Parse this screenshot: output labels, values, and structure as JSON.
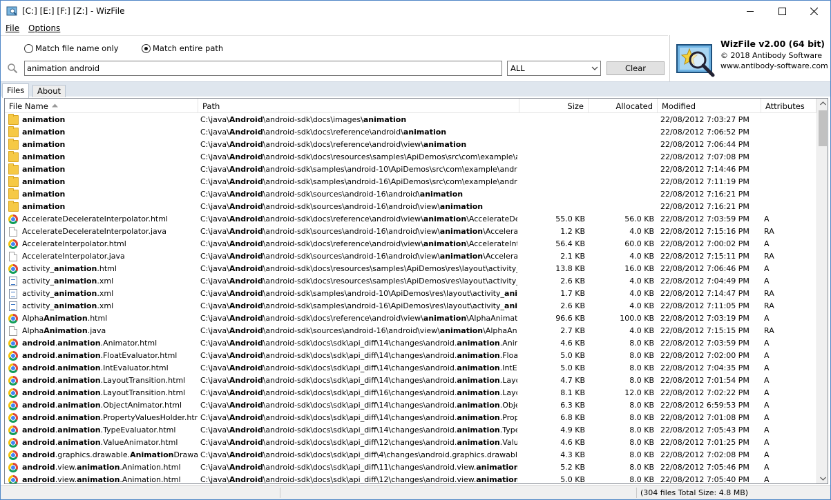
{
  "window": {
    "title": "[C:] [E:] [F:] [Z:]  - WizFile"
  },
  "menu": {
    "file": "File",
    "options": "Options"
  },
  "search": {
    "match_name_label": "Match file name only",
    "match_path_label": "Match entire path",
    "selected_mode": "path",
    "query": "animation android",
    "filter_value": "ALL",
    "clear_label": "Clear"
  },
  "brand": {
    "name": "WizFile v2.00 (64 bit)",
    "copyright": "© 2018 Antibody Software",
    "website": "www.antibody-software.com"
  },
  "tabs": {
    "files": "Files",
    "about": "About"
  },
  "columns": {
    "name": "File Name",
    "path": "Path",
    "size": "Size",
    "allocated": "Allocated",
    "modified": "Modified",
    "attributes": "Attributes"
  },
  "rows": [
    {
      "icon": "folder",
      "name": "<b>animation</b>",
      "path": "C:\\java\\<b>Android</b>\\android-sdk\\docs\\images\\<b>animation</b>",
      "size": "",
      "alloc": "",
      "modified": "22/08/2012 7:03:27 PM",
      "attr": ""
    },
    {
      "icon": "folder",
      "name": "<b>animation</b>",
      "path": "C:\\java\\<b>Android</b>\\android-sdk\\docs\\reference\\android\\<b>animation</b>",
      "size": "",
      "alloc": "",
      "modified": "22/08/2012 7:06:52 PM",
      "attr": ""
    },
    {
      "icon": "folder",
      "name": "<b>animation</b>",
      "path": "C:\\java\\<b>Android</b>\\android-sdk\\docs\\reference\\android\\view\\<b>animation</b>",
      "size": "",
      "alloc": "",
      "modified": "22/08/2012 7:06:44 PM",
      "attr": ""
    },
    {
      "icon": "folder",
      "name": "<b>animation</b>",
      "path": "C:\\java\\<b>Android</b>\\android-sdk\\docs\\resources\\samples\\ApiDemos\\src\\com\\example\\android\\apis",
      "size": "",
      "alloc": "",
      "modified": "22/08/2012 7:07:08 PM",
      "attr": ""
    },
    {
      "icon": "folder",
      "name": "<b>animation</b>",
      "path": "C:\\java\\<b>Android</b>\\android-sdk\\samples\\android-10\\ApiDemos\\src\\com\\example\\android\\apis\\<b>an</b>",
      "size": "",
      "alloc": "",
      "modified": "22/08/2012 7:14:46 PM",
      "attr": ""
    },
    {
      "icon": "folder",
      "name": "<b>animation</b>",
      "path": "C:\\java\\<b>Android</b>\\android-sdk\\samples\\android-16\\ApiDemos\\src\\com\\example\\android\\apis\\<b>an</b>",
      "size": "",
      "alloc": "",
      "modified": "22/08/2012 7:11:19 PM",
      "attr": ""
    },
    {
      "icon": "folder",
      "name": "<b>animation</b>",
      "path": "C:\\java\\<b>Android</b>\\android-sdk\\sources\\android-16\\android\\<b>animation</b>",
      "size": "",
      "alloc": "",
      "modified": "22/08/2012 7:16:21 PM",
      "attr": ""
    },
    {
      "icon": "folder",
      "name": "<b>animation</b>",
      "path": "C:\\java\\<b>Android</b>\\android-sdk\\sources\\android-16\\android\\view\\<b>animation</b>",
      "size": "",
      "alloc": "",
      "modified": "22/08/2012 7:16:21 PM",
      "attr": ""
    },
    {
      "icon": "chrome",
      "name": "AccelerateDecelerateInterpolator.html",
      "path": "C:\\java\\<b>Android</b>\\android-sdk\\docs\\reference\\android\\view\\<b>animation</b>\\AccelerateDecelerateI",
      "size": "55.0 KB",
      "alloc": "56.0 KB",
      "modified": "22/08/2012 7:03:59 PM",
      "attr": "A"
    },
    {
      "icon": "doc",
      "name": "AccelerateDecelerateInterpolator.java",
      "path": "C:\\java\\<b>Android</b>\\android-sdk\\sources\\android-16\\android\\view\\<b>animation</b>\\AccelerateDeceler",
      "size": "1.2 KB",
      "alloc": "4.0 KB",
      "modified": "22/08/2012 7:15:16 PM",
      "attr": "RA"
    },
    {
      "icon": "chrome",
      "name": "AccelerateInterpolator.html",
      "path": "C:\\java\\<b>Android</b>\\android-sdk\\docs\\reference\\android\\view\\<b>animation</b>\\AccelerateInterpolato",
      "size": "56.4 KB",
      "alloc": "60.0 KB",
      "modified": "22/08/2012 7:00:02 PM",
      "attr": "A"
    },
    {
      "icon": "doc",
      "name": "AccelerateInterpolator.java",
      "path": "C:\\java\\<b>Android</b>\\android-sdk\\sources\\android-16\\android\\view\\<b>animation</b>\\AccelerateInterpo",
      "size": "2.1 KB",
      "alloc": "4.0 KB",
      "modified": "22/08/2012 7:15:11 PM",
      "attr": "RA"
    },
    {
      "icon": "chrome",
      "name": "activity_<b>animation</b>.html",
      "path": "C:\\java\\<b>Android</b>\\android-sdk\\docs\\resources\\samples\\ApiDemos\\res\\layout\\activity_<b>animatio</b>",
      "size": "13.8 KB",
      "alloc": "16.0 KB",
      "modified": "22/08/2012 7:06:46 PM",
      "attr": "A"
    },
    {
      "icon": "xml",
      "name": "activity_<b>animation</b>.xml",
      "path": "C:\\java\\<b>Android</b>\\android-sdk\\docs\\resources\\samples\\ApiDemos\\res\\layout\\activity_<b>animatio</b>",
      "size": "2.6 KB",
      "alloc": "4.0 KB",
      "modified": "22/08/2012 7:04:49 PM",
      "attr": "A"
    },
    {
      "icon": "xml",
      "name": "activity_<b>animation</b>.xml",
      "path": "C:\\java\\<b>Android</b>\\android-sdk\\samples\\android-10\\ApiDemos\\res\\layout\\activity_<b>animation</b>.x",
      "size": "1.7 KB",
      "alloc": "4.0 KB",
      "modified": "22/08/2012 7:14:47 PM",
      "attr": "RA"
    },
    {
      "icon": "xml",
      "name": "activity_<b>animation</b>.xml",
      "path": "C:\\java\\<b>Android</b>\\android-sdk\\samples\\android-16\\ApiDemos\\res\\layout\\activity_<b>animation</b>.x",
      "size": "2.6 KB",
      "alloc": "4.0 KB",
      "modified": "22/08/2012 7:11:05 PM",
      "attr": "RA"
    },
    {
      "icon": "chrome",
      "name": "Alpha<b>Animation</b>.html",
      "path": "C:\\java\\<b>Android</b>\\android-sdk\\docs\\reference\\android\\view\\<b>animation</b>\\AlphaAnimation.html",
      "size": "96.6 KB",
      "alloc": "100.0 KB",
      "modified": "22/08/2012 7:03:19 PM",
      "attr": "A"
    },
    {
      "icon": "doc",
      "name": "Alpha<b>Animation</b>.java",
      "path": "C:\\java\\<b>Android</b>\\android-sdk\\sources\\android-16\\android\\view\\<b>animation</b>\\AlphaAnimation.ja",
      "size": "2.7 KB",
      "alloc": "4.0 KB",
      "modified": "22/08/2012 7:15:15 PM",
      "attr": "RA"
    },
    {
      "icon": "chrome",
      "name": "<b>android</b>.<b>animation</b>.Animator.html",
      "path": "C:\\java\\<b>Android</b>\\android-sdk\\docs\\sdk\\api_diff\\14\\changes\\android.<b>animation</b>.Animator.htm",
      "size": "4.6 KB",
      "alloc": "8.0 KB",
      "modified": "22/08/2012 7:03:59 PM",
      "attr": "A"
    },
    {
      "icon": "chrome",
      "name": "<b>android</b>.<b>animation</b>.FloatEvaluator.html",
      "path": "C:\\java\\<b>Android</b>\\android-sdk\\docs\\sdk\\api_diff\\14\\changes\\android.<b>animation</b>.FloatEvaluato",
      "size": "5.0 KB",
      "alloc": "8.0 KB",
      "modified": "22/08/2012 7:02:00 PM",
      "attr": "A"
    },
    {
      "icon": "chrome",
      "name": "<b>android</b>.<b>animation</b>.IntEvaluator.html",
      "path": "C:\\java\\<b>Android</b>\\android-sdk\\docs\\sdk\\api_diff\\14\\changes\\android.<b>animation</b>.IntEvaluator.",
      "size": "5.0 KB",
      "alloc": "8.0 KB",
      "modified": "22/08/2012 7:04:35 PM",
      "attr": "A"
    },
    {
      "icon": "chrome",
      "name": "<b>android</b>.<b>animation</b>.LayoutTransition.html",
      "path": "C:\\java\\<b>Android</b>\\android-sdk\\docs\\sdk\\api_diff\\14\\changes\\android.<b>animation</b>.LayoutTransi",
      "size": "4.7 KB",
      "alloc": "8.0 KB",
      "modified": "22/08/2012 7:01:54 PM",
      "attr": "A"
    },
    {
      "icon": "chrome",
      "name": "<b>android</b>.<b>animation</b>.LayoutTransition.html",
      "path": "C:\\java\\<b>Android</b>\\android-sdk\\docs\\sdk\\api_diff\\16\\changes\\android.<b>animation</b>.LayoutTransi",
      "size": "8.1 KB",
      "alloc": "12.0 KB",
      "modified": "22/08/2012 7:02:22 PM",
      "attr": "A"
    },
    {
      "icon": "chrome",
      "name": "<b>android</b>.<b>animation</b>.ObjectAnimator.html",
      "path": "C:\\java\\<b>Android</b>\\android-sdk\\docs\\sdk\\api_diff\\14\\changes\\android.<b>animation</b>.ObjectAnima",
      "size": "6.3 KB",
      "alloc": "8.0 KB",
      "modified": "22/08/2012 6:59:53 PM",
      "attr": "A"
    },
    {
      "icon": "chrome",
      "name": "<b>android</b>.<b>animation</b>.PropertyValuesHolder.html",
      "path": "C:\\java\\<b>Android</b>\\android-sdk\\docs\\sdk\\api_diff\\14\\changes\\android.<b>animation</b>.PropertyValu",
      "size": "6.8 KB",
      "alloc": "8.0 KB",
      "modified": "22/08/2012 7:01:08 PM",
      "attr": "A"
    },
    {
      "icon": "chrome",
      "name": "<b>android</b>.<b>animation</b>.TypeEvaluator.html",
      "path": "C:\\java\\<b>Android</b>\\android-sdk\\docs\\sdk\\api_diff\\14\\changes\\android.<b>animation</b>.TypeEvaluato",
      "size": "4.9 KB",
      "alloc": "8.0 KB",
      "modified": "22/08/2012 7:05:43 PM",
      "attr": "A"
    },
    {
      "icon": "chrome",
      "name": "<b>android</b>.<b>animation</b>.ValueAnimator.html",
      "path": "C:\\java\\<b>Android</b>\\android-sdk\\docs\\sdk\\api_diff\\12\\changes\\android.<b>animation</b>.ValueAnimat",
      "size": "4.6 KB",
      "alloc": "8.0 KB",
      "modified": "22/08/2012 7:01:25 PM",
      "attr": "A"
    },
    {
      "icon": "chrome",
      "name": "<b>android</b>.graphics.drawable.<b>Animation</b>Drawable.h",
      "path": "C:\\java\\<b>Android</b>\\android-sdk\\docs\\sdk\\api_diff\\4\\changes\\android.graphics.drawable.<b>Animat</b>",
      "size": "4.3 KB",
      "alloc": "8.0 KB",
      "modified": "22/08/2012 7:02:08 PM",
      "attr": "A"
    },
    {
      "icon": "chrome",
      "name": "<b>android</b>.view.<b>animation</b>.Animation.html",
      "path": "C:\\java\\<b>Android</b>\\android-sdk\\docs\\sdk\\api_diff\\11\\changes\\android.view.<b>animation</b>.Animatio",
      "size": "5.2 KB",
      "alloc": "8.0 KB",
      "modified": "22/08/2012 7:05:46 PM",
      "attr": "A"
    },
    {
      "icon": "chrome",
      "name": "<b>android</b>.view.<b>animation</b>.Animation.html",
      "path": "C:\\java\\<b>Android</b>\\android-sdk\\docs\\sdk\\api_diff\\12\\changes\\android.view.<b>animation</b>.Animatio",
      "size": "5.0 KB",
      "alloc": "8.0 KB",
      "modified": "22/08/2012 7:05:40 PM",
      "attr": "A"
    }
  ],
  "status": {
    "summary": "(304 files  Total Size: 4.8 MB)"
  }
}
